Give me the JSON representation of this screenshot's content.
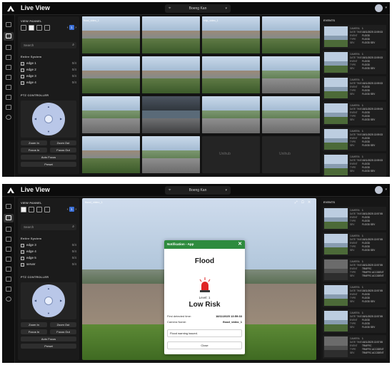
{
  "app": {
    "title": "Live View",
    "site": "Boeng Kan"
  },
  "panel": {
    "view_title": "VIEW PANNEL",
    "page": "1",
    "search_placeholder": "Search",
    "edge_title": "Entire System",
    "ptz_title": "PTZ CONTROLLER",
    "buttons": {
      "zoom_in": "Zoom In",
      "zoom_out": "Zoom Out",
      "focus_in": "Focus In",
      "focus_out": "Focus Out",
      "auto_focus": "Auto Focus",
      "preset": "Preset"
    }
  },
  "shot1": {
    "edges": [
      {
        "label": "edge 1",
        "count": "0/4"
      },
      {
        "label": "edge 2",
        "count": "0/4"
      },
      {
        "label": "edge 3",
        "count": "0/4"
      },
      {
        "label": "edge 4",
        "count": "0/4"
      }
    ],
    "tiles": [
      {
        "name": "flood_video_1"
      },
      {
        "name": ""
      },
      {
        "name": "ship_video_1"
      },
      {
        "name": ""
      },
      {
        "name": ""
      },
      {
        "name": ""
      },
      {
        "name": ""
      },
      {
        "name": ""
      },
      {
        "name": ""
      },
      {
        "name": ""
      },
      {
        "name": ""
      },
      {
        "name": ""
      },
      {
        "name": ""
      },
      {
        "name": ""
      },
      {
        "name": ""
      },
      {
        "name": ""
      }
    ],
    "no_signal": "Unihub"
  },
  "shot2": {
    "edges": [
      {
        "label": "edge 3",
        "count": "0/4"
      },
      {
        "label": "edge 4",
        "count": "0/4"
      },
      {
        "label": "edge 5",
        "count": "0/4"
      },
      {
        "label": "server",
        "count": "0/4"
      }
    ],
    "feature_name": "flood_video_1"
  },
  "events": {
    "title": "EVENTS",
    "keys": {
      "camera": "CAMERA",
      "date": "DATE TIME",
      "event": "EVENT",
      "type": "TYPE",
      "sev": "SEV"
    },
    "shot1": [
      {
        "camera": "1",
        "date": "18/11/2025 13:59:33",
        "event": "FLOOD",
        "type": "FLOOD",
        "sev": "FLOOD SEV"
      },
      {
        "camera": "1",
        "date": "18/11/2025 13:59:33",
        "event": "FLOOD",
        "type": "FLOOD",
        "sev": "FLOOD SEV"
      },
      {
        "camera": "1",
        "date": "18/11/2025 13:59:33",
        "event": "FLOOD",
        "type": "FLOOD",
        "sev": "FLOOD SEV"
      },
      {
        "camera": "1",
        "date": "18/11/2025 13:59:33",
        "event": "FLOOD",
        "type": "FLOOD",
        "sev": "FLOOD SEV"
      },
      {
        "camera": "1",
        "date": "18/11/2025 13:59:33",
        "event": "FLOOD",
        "type": "FLOOD",
        "sev": "FLOOD SEV"
      },
      {
        "camera": "1",
        "date": "18/11/2025 13:59:33",
        "event": "FLOOD",
        "type": "FLOOD",
        "sev": "FLOOD SEV"
      }
    ],
    "shot2": [
      {
        "camera": "1",
        "date": "18/11/2025 13:57:55",
        "event": "FLOOD",
        "type": "FLOOD",
        "sev": "FLOOD SEV"
      },
      {
        "camera": "1",
        "date": "18/11/2025 13:57:55",
        "event": "FLOOD",
        "type": "FLOOD",
        "sev": "FLOOD SEV"
      },
      {
        "camera": "1",
        "date": "18/11/2025 13:57:55",
        "event": "TRAFFIC",
        "type": "TRAFFIC ACCIDENT",
        "sev": "TRAFFIC ACCIDENT"
      },
      {
        "camera": "1",
        "date": "18/11/2025 13:57:55",
        "event": "FLOOD",
        "type": "FLOOD",
        "sev": "FLOOD SEV"
      },
      {
        "camera": "1",
        "date": "18/11/2025 13:57:55",
        "event": "FLOOD",
        "type": "FLOOD",
        "sev": "FLOOD SEV"
      },
      {
        "camera": "1",
        "date": "18/11/2025 13:57:55",
        "event": "TRAFFIC",
        "type": "TRAFFIC ACCIDENT",
        "sev": "TRAFFIC ACCIDENT"
      }
    ]
  },
  "dialog": {
    "header": "Notification - App",
    "close_x": "✕",
    "type": "Flood",
    "level": "Level: 1",
    "risk": "Low Risk",
    "first_label": "First detected time:",
    "first_value": "18/11/2025 13:59:33",
    "camera_label": "Camera Name:",
    "camera_value": "flood_video_1",
    "message": "Flood warning issued.",
    "close_button": "Close"
  },
  "icons": {
    "pin": "⌖",
    "caret": "▾",
    "search": "⌕",
    "left": "‹",
    "right": "›",
    "up": "▲",
    "down": "▼",
    "lt": "◀",
    "rt": "▶",
    "tools": "⤢ ▢ ✕"
  },
  "colors": {
    "accent_blue": "#3b6fd6",
    "dialog_green": "#2e8b3e",
    "siren_red": "#e02424"
  }
}
